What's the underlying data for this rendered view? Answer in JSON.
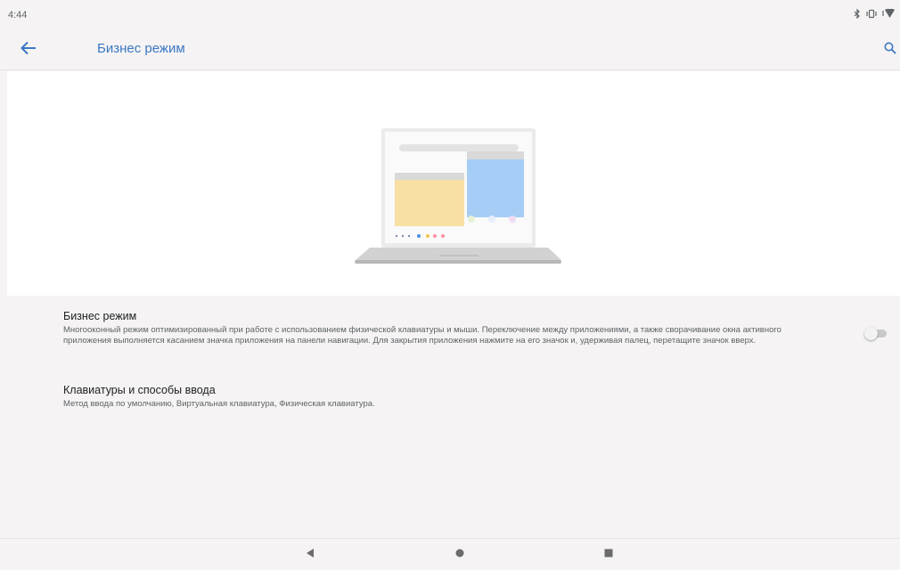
{
  "status_bar": {
    "time": "4:44",
    "icons": [
      "bluetooth-icon",
      "vibrate-icon",
      "wifi-icon"
    ]
  },
  "app_bar": {
    "title": "Бизнес режим",
    "back_icon": "arrow-back-icon",
    "search_icon": "search-icon",
    "accent_color": "#3b78c5"
  },
  "hero": {
    "illustration": "laptop-multiwindow-illustration"
  },
  "preferences": [
    {
      "title": "Бизнес режим",
      "summary": "Многооконный режим оптимизированный при работе с использованием физической клавиатуры и мыши. Переключение между приложениями, а также сворачивание окна активного приложения выполняется касанием значка приложения на панели навигации. Для закрытия приложения нажмите на его значок и, удерживая палец, перетащите значок вверх.",
      "toggle_on": false
    },
    {
      "title": "Клавиатуры и способы ввода",
      "summary": "Метод ввода по умолчанию, Виртуальная клавиатура, Физическая клавиатура."
    }
  ],
  "nav_bar": {
    "icons": [
      "nav-back-icon",
      "nav-home-icon",
      "nav-recents-icon"
    ]
  }
}
